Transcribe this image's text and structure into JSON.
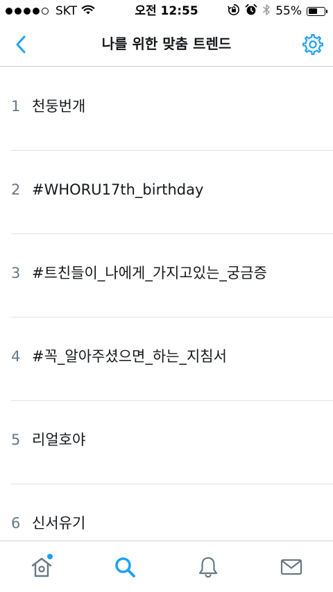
{
  "status_bar": {
    "carrier": "SKT",
    "time": "오전 12:55",
    "battery_text": "55%",
    "battery_level": 0.55
  },
  "header": {
    "title": "나를 위한 맞춤 트렌드",
    "back_icon": "chevron-left-icon",
    "settings_icon": "gear-icon"
  },
  "trends": [
    {
      "rank": "1",
      "name": "천둥번개"
    },
    {
      "rank": "2",
      "name": "#WHORU17th_birthday"
    },
    {
      "rank": "3",
      "name": "#트친들이_나에게_가지고있는_궁금증"
    },
    {
      "rank": "4",
      "name": "#꼭_알아주셨으면_하는_지침서"
    },
    {
      "rank": "5",
      "name": "리얼호야"
    },
    {
      "rank": "6",
      "name": "신서유기"
    }
  ],
  "tab_bar": {
    "tabs": [
      {
        "name": "home",
        "icon": "home-icon",
        "active": false,
        "has_notification": true
      },
      {
        "name": "search",
        "icon": "search-icon",
        "active": true,
        "has_notification": false
      },
      {
        "name": "notifications",
        "icon": "bell-icon",
        "active": false,
        "has_notification": false
      },
      {
        "name": "messages",
        "icon": "mail-icon",
        "active": false,
        "has_notification": false
      }
    ]
  },
  "colors": {
    "accent": "#1da1f2",
    "icon_gray": "#657786",
    "text": "#14171a",
    "divider": "#dfe3e6"
  }
}
